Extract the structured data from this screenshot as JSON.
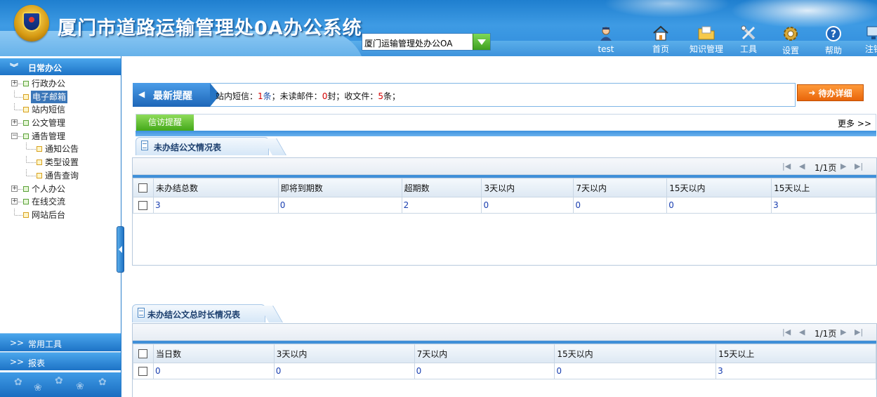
{
  "header": {
    "title": "厦门市道路运输管理处0A办公系统",
    "system_select": "厦门运输管理处办公OA",
    "nav": [
      {
        "key": "user",
        "label": "test"
      },
      {
        "key": "home",
        "label": "首页"
      },
      {
        "key": "knowledge",
        "label": "知识管理"
      },
      {
        "key": "tools",
        "label": "工具"
      },
      {
        "key": "settings",
        "label": "设置"
      },
      {
        "key": "help",
        "label": "帮助"
      },
      {
        "key": "logout",
        "label": "注销"
      }
    ]
  },
  "sidebar": {
    "section_title": "日常办公",
    "tree": [
      {
        "label": "行政办公",
        "level": 0,
        "expandable": true,
        "expanded": false
      },
      {
        "label": "电子邮箱",
        "level": 0,
        "expandable": false,
        "selected": true
      },
      {
        "label": "站内短信",
        "level": 0,
        "expandable": false
      },
      {
        "label": "公文管理",
        "level": 0,
        "expandable": true,
        "expanded": false
      },
      {
        "label": "通告管理",
        "level": 0,
        "expandable": true,
        "expanded": true
      },
      {
        "label": "通知公告",
        "level": 1
      },
      {
        "label": "类型设置",
        "level": 1
      },
      {
        "label": "通告查询",
        "level": 1
      },
      {
        "label": "个人办公",
        "level": 0,
        "expandable": true,
        "expanded": false
      },
      {
        "label": "在线交流",
        "level": 0,
        "expandable": true,
        "expanded": false
      },
      {
        "label": "网站后台",
        "level": 0,
        "expandable": false
      }
    ],
    "bottom_sections": [
      "常用工具",
      "报表"
    ]
  },
  "notice": {
    "badge": "最新提醒",
    "sms_label": "站内短信：",
    "sms_count": "1",
    "sms_unit": "条",
    "mail_label": "；未读邮件：",
    "mail_count": "0",
    "mail_unit": "封",
    "doc_label": "；收文件：",
    "doc_count": "5",
    "doc_unit": "条；"
  },
  "todo_button": "待办详细",
  "tabs": {
    "active": "信访提醒",
    "more": "更多"
  },
  "table1": {
    "title": "未办结公文情况表",
    "page_info": "1/1页",
    "columns": [
      "未办结总数",
      "即将到期数",
      "超期数",
      "3天以内",
      "7天以内",
      "15天以内",
      "15天以上"
    ],
    "rows": [
      [
        "3",
        "0",
        "2",
        "0",
        "0",
        "0",
        "3"
      ]
    ]
  },
  "table2": {
    "title": "未办结公文总时长情况表",
    "page_info": "1/1页",
    "columns": [
      "当日数",
      "3天以内",
      "7天以内",
      "15天以内",
      "15天以上"
    ],
    "rows": [
      [
        "0",
        "0",
        "0",
        "0",
        "3"
      ]
    ]
  },
  "colors": {
    "header_blue": "#2f8bdb",
    "sidebar_blue": "#1d73c6",
    "todo_orange": "#e8650a",
    "tab_green": "#43a81a",
    "notice_count_red": "#d40000",
    "table_value_blue": "#1a3fb0"
  }
}
